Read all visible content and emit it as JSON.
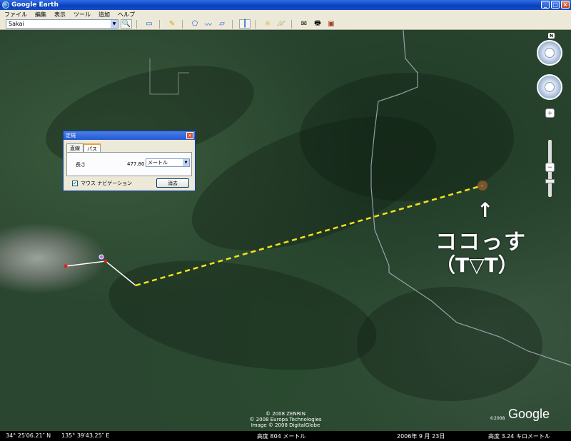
{
  "window": {
    "title": "Google Earth"
  },
  "menu": [
    "ファイル",
    "編集",
    "表示",
    "ツール",
    "追加",
    "ヘルプ"
  ],
  "search": {
    "value": "Sakai"
  },
  "dialog": {
    "title": "定規",
    "tabs": [
      "直線",
      "パス"
    ],
    "active_tab": "パス",
    "length_label": "長さ",
    "length_value": "477.80",
    "unit": "メートル",
    "mouse_nav_label": "マウス ナビゲーション",
    "mouse_nav_checked": true,
    "clear_label": "消去"
  },
  "annotation": {
    "arrow": "↑",
    "line1": "ココっす",
    "line2": "（T▽T）"
  },
  "credits": {
    "line1": "© 2008 ZENRIN",
    "line2": "© 2008 Europa Technologies",
    "line3": "Image © 2008 DigitalGlobe"
  },
  "branding": {
    "copyright": "©2008",
    "logo": "Google"
  },
  "status": {
    "lat": "34° 25′06.21″ N",
    "lon": "135° 39′43.25″ E",
    "altitude": "高度  804 メートル",
    "date": "2006年 9 月 23日",
    "eye_altitude": "高度   3.24 キロメートル"
  },
  "colors": {
    "path_line": "#f5e21a",
    "measure_line": "#ffffff",
    "point": "#e02020"
  }
}
